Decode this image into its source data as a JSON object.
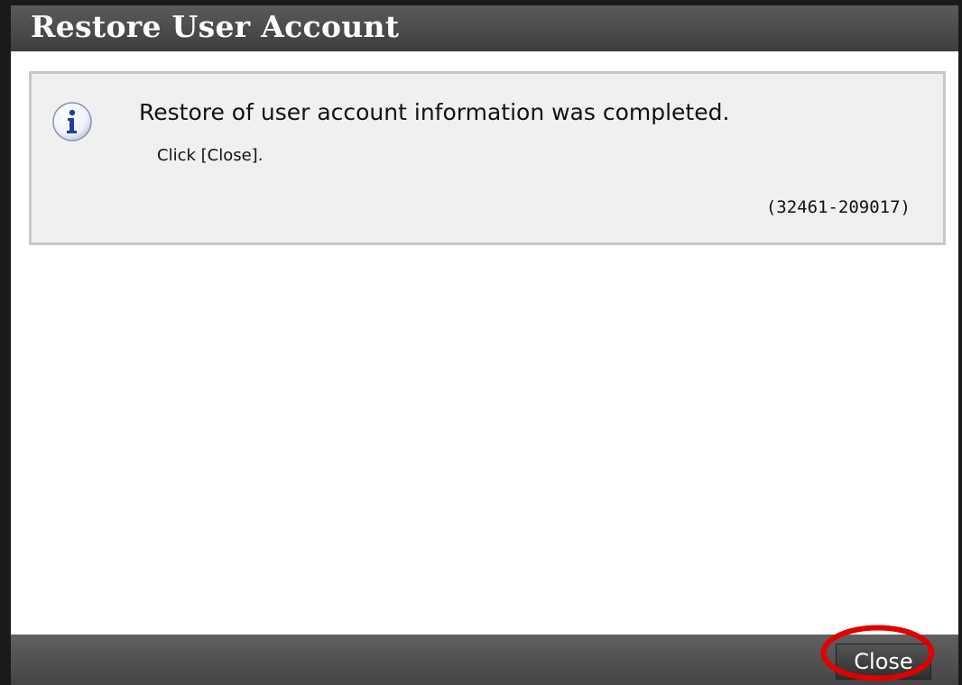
{
  "dialog": {
    "title": "Restore User Account",
    "message": {
      "icon": "info-icon",
      "main_text": "Restore of user account information was completed.",
      "sub_text": "Click [Close].",
      "code": "(32461-209017)"
    },
    "footer": {
      "close_label": "Close"
    }
  },
  "annotation": {
    "shape": "ellipse",
    "target": "close-button",
    "color": "#e00000"
  },
  "colors": {
    "titlebar": "#4a4a4a",
    "footer": "#505050",
    "message_background": "#f0f0f0",
    "message_border": "#c8c8c8",
    "info_icon_blue": "#1f3fa0"
  }
}
